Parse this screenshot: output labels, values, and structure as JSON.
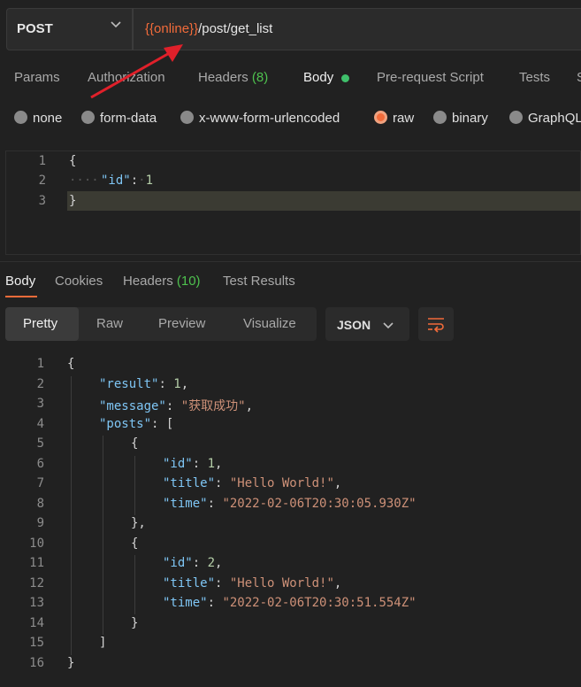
{
  "request": {
    "method": "POST",
    "url_variable": "{{online}}",
    "url_path": "/post/get_list"
  },
  "tabs": [
    {
      "label": "Params"
    },
    {
      "label": "Authorization"
    },
    {
      "label": "Headers",
      "count": "(8)"
    },
    {
      "label": "Body"
    },
    {
      "label": "Pre-request Script"
    },
    {
      "label": "Tests"
    },
    {
      "label": "S"
    }
  ],
  "body_types": [
    "none",
    "form-data",
    "x-www-form-urlencoded",
    "raw",
    "binary",
    "GraphQL"
  ],
  "selected_body_type": "raw",
  "request_body": {
    "line_numbers": [
      "1",
      "2",
      "3"
    ],
    "open": "{",
    "key": "\"id\"",
    "colon": ":",
    "value": "1",
    "close": "}"
  },
  "response_tabs": [
    {
      "label": "Body"
    },
    {
      "label": "Cookies"
    },
    {
      "label": "Headers",
      "count": "(10)"
    },
    {
      "label": "Test Results"
    }
  ],
  "view_modes": [
    "Pretty",
    "Raw",
    "Preview",
    "Visualize"
  ],
  "format": "JSON",
  "response": {
    "line_numbers": [
      "1",
      "2",
      "3",
      "4",
      "5",
      "6",
      "7",
      "8",
      "9",
      "10",
      "11",
      "12",
      "13",
      "14",
      "15",
      "16"
    ],
    "result_key": "\"result\"",
    "result_val": "1",
    "message_key": "\"message\"",
    "message_val": "\"获取成功\"",
    "posts_key": "\"posts\"",
    "p1_id_key": "\"id\"",
    "p1_id_val": "1",
    "p1_title_key": "\"title\"",
    "p1_title_val": "\"Hello World!\"",
    "p1_time_key": "\"time\"",
    "p1_time_val": "\"2022-02-06T20:30:05.930Z\"",
    "p2_id_key": "\"id\"",
    "p2_id_val": "2",
    "p2_title_key": "\"title\"",
    "p2_title_val": "\"Hello World!\"",
    "p2_time_key": "\"time\"",
    "p2_time_val": "\"2022-02-06T20:30:51.554Z\""
  },
  "colors": {
    "accent": "#f26b3a",
    "annotation_arrow": "#e0202a",
    "key": "#7fc6f5",
    "string": "#ce9178",
    "number": "#b5cea8",
    "count": "#4ec14e"
  }
}
